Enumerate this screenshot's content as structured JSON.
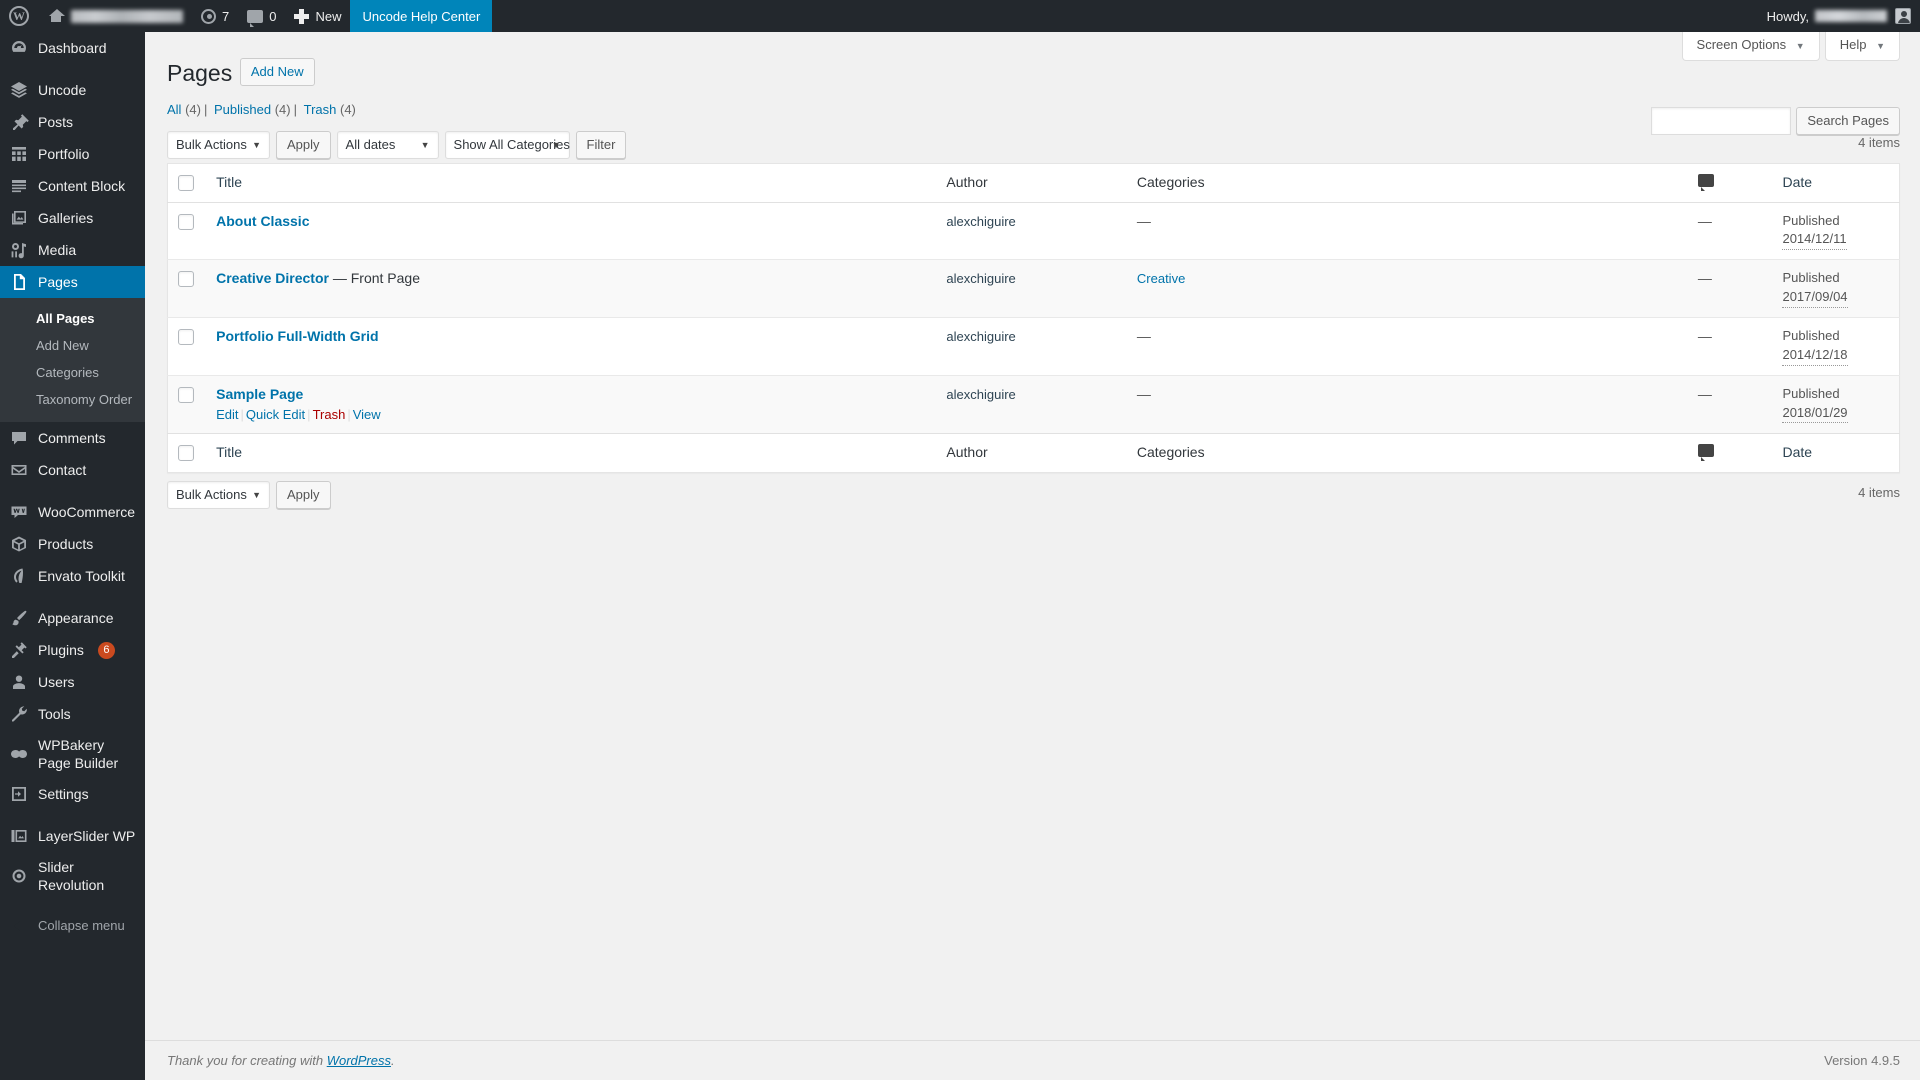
{
  "adminbar": {
    "wp_logo_icon": "wordpress-logo-icon",
    "home_icon": "home-icon",
    "site_name": "",
    "updates_icon": "updates-icon",
    "updates_count": "7",
    "comments_icon": "comment-bubble-icon",
    "comments_count": "0",
    "new_icon": "plus-icon",
    "new_label": "New",
    "help_center_label": "Uncode Help Center",
    "howdy_label": "Howdy,",
    "user_name": "",
    "avatar_icon": "user-avatar-icon",
    "accent_blue": "#0085ba",
    "bar_bg": "#23282d"
  },
  "sidebar": {
    "items": [
      {
        "label": "Dashboard",
        "icon": "dashboard-icon",
        "name": "dashboard"
      },
      {
        "label": "Uncode",
        "icon": "layers-icon",
        "name": "uncode"
      },
      {
        "label": "Posts",
        "icon": "pin-icon",
        "name": "posts"
      },
      {
        "label": "Portfolio",
        "icon": "grid-icon",
        "name": "portfolio"
      },
      {
        "label": "Content Block",
        "icon": "content-block-icon",
        "name": "content-block"
      },
      {
        "label": "Galleries",
        "icon": "gallery-icon",
        "name": "galleries"
      },
      {
        "label": "Media",
        "icon": "media-icon",
        "name": "media"
      },
      {
        "label": "Pages",
        "icon": "page-icon",
        "name": "pages",
        "active": true
      },
      {
        "label": "Comments",
        "icon": "comment-bubble-icon",
        "name": "comments"
      },
      {
        "label": "Contact",
        "icon": "envelope-icon",
        "name": "contact"
      },
      {
        "label": "WooCommerce",
        "icon": "woocommerce-icon",
        "name": "woocommerce"
      },
      {
        "label": "Products",
        "icon": "box-icon",
        "name": "products"
      },
      {
        "label": "Envato Toolkit",
        "icon": "envato-leaf-icon",
        "name": "envato-toolkit"
      },
      {
        "label": "Appearance",
        "icon": "paintbrush-icon",
        "name": "appearance"
      },
      {
        "label": "Plugins",
        "icon": "plug-icon",
        "name": "plugins",
        "badge": "6"
      },
      {
        "label": "Users",
        "icon": "user-icon",
        "name": "users"
      },
      {
        "label": "Tools",
        "icon": "wrench-icon",
        "name": "tools"
      },
      {
        "label": "WPBakery Page Builder",
        "icon": "wpbakery-icon",
        "name": "wpbakery-page-builder"
      },
      {
        "label": "Settings",
        "icon": "settings-sliders-icon",
        "name": "settings"
      },
      {
        "label": "LayerSlider WP",
        "icon": "layerslider-icon",
        "name": "layerslider-wp"
      },
      {
        "label": "Slider Revolution",
        "icon": "slider-revolution-icon",
        "name": "slider-revolution"
      }
    ],
    "submenu": [
      {
        "label": "All Pages",
        "current": true
      },
      {
        "label": "Add New",
        "current": false
      },
      {
        "label": "Categories",
        "current": false
      },
      {
        "label": "Taxonomy Order",
        "current": false
      }
    ],
    "collapse_label": "Collapse menu",
    "collapse_icon": "collapse-arrow-icon",
    "badge_color": "#ca4a1f",
    "active_color": "#0073aa"
  },
  "screen_meta": {
    "screen_options_label": "Screen Options",
    "help_label": "Help",
    "caret_icon": "chevron-down-icon"
  },
  "header": {
    "title": "Pages",
    "add_new_label": "Add New"
  },
  "filters": {
    "all_label": "All",
    "all_count": "(4)",
    "published_label": "Published",
    "published_count": "(4)",
    "trash_label": "Trash",
    "trash_count": "(4)",
    "separator": "|"
  },
  "search": {
    "value": "",
    "placeholder": "",
    "button_label": "Search Pages"
  },
  "tablenav_top": {
    "bulk_actions_label": "Bulk Actions",
    "apply_label": "Apply",
    "dates_label": "All dates",
    "categories_label": "Show All Categories",
    "filter_label": "Filter",
    "items_count": "4 items"
  },
  "tablenav_bottom": {
    "bulk_actions_label": "Bulk Actions",
    "apply_label": "Apply",
    "items_count": "4 items"
  },
  "table": {
    "columns": {
      "title": "Title",
      "author": "Author",
      "categories": "Categories",
      "comments_icon": "comment-bubble-icon",
      "date": "Date"
    },
    "rows": [
      {
        "title": "About Classic",
        "suffix": "",
        "author": "alexchiguire",
        "categories": "—",
        "categories_is_link": false,
        "comments": "—",
        "status": "Published",
        "date": "2014/12/11"
      },
      {
        "title": "Creative Director",
        "suffix": " — Front Page",
        "author": "alexchiguire",
        "categories": "Creative",
        "categories_is_link": true,
        "comments": "—",
        "status": "Published",
        "date": "2017/09/04"
      },
      {
        "title": "Portfolio Full-Width Grid",
        "suffix": "",
        "author": "alexchiguire",
        "categories": "—",
        "categories_is_link": false,
        "comments": "—",
        "status": "Published",
        "date": "2014/12/18"
      },
      {
        "title": "Sample Page",
        "suffix": "",
        "author": "alexchiguire",
        "categories": "—",
        "categories_is_link": false,
        "comments": "—",
        "status": "Published",
        "date": "2018/01/29"
      }
    ],
    "row_actions": {
      "edit": "Edit",
      "quick_edit": "Quick Edit",
      "trash": "Trash",
      "view": "View",
      "divider": "|"
    }
  },
  "footer": {
    "thanks_prefix": "Thank you for creating with ",
    "wordpress_link": "WordPress",
    "thanks_suffix": ".",
    "version": "Version 4.9.5"
  }
}
